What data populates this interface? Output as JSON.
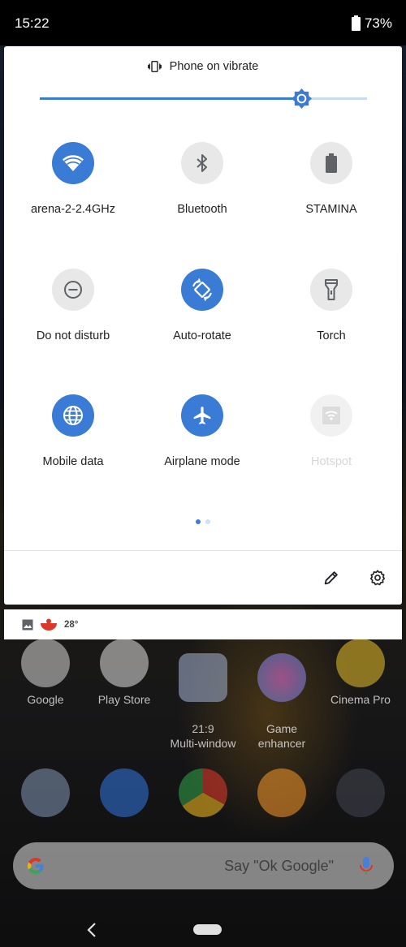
{
  "status_bar": {
    "time": "15:22",
    "battery": "73%"
  },
  "quick_settings": {
    "ringer_label": "Phone on vibrate",
    "brightness_level": 0.8,
    "tiles": [
      {
        "label": "arena-2-2.4GHz",
        "icon": "wifi-icon",
        "state": "on"
      },
      {
        "label": "Bluetooth",
        "icon": "bluetooth-icon",
        "state": "off"
      },
      {
        "label": "STAMINA",
        "icon": "battery-icon",
        "state": "off"
      },
      {
        "label": "Do not disturb",
        "icon": "do-not-disturb-icon",
        "state": "off"
      },
      {
        "label": "Auto-rotate",
        "icon": "auto-rotate-icon",
        "state": "on"
      },
      {
        "label": "Torch",
        "icon": "torch-icon",
        "state": "off"
      },
      {
        "label": "Mobile data",
        "icon": "globe-icon",
        "state": "on"
      },
      {
        "label": "Airplane mode",
        "icon": "airplane-icon",
        "state": "on"
      },
      {
        "label": "Hotspot",
        "icon": "hotspot-icon",
        "state": "unavailable"
      }
    ],
    "page_count": 2,
    "current_page": 1
  },
  "notification": {
    "temperature": "28°"
  },
  "home": {
    "apps": [
      {
        "label": "Google"
      },
      {
        "label": "Play Store"
      },
      {
        "label": "21:9\nMulti-window"
      },
      {
        "label": "Game\nenhancer"
      },
      {
        "label": "Cinema Pro"
      }
    ],
    "search_hint": "Say \"Ok Google\""
  },
  "colors": {
    "accent": "#3a7bd5",
    "tile_off": "#e8e8e8"
  }
}
